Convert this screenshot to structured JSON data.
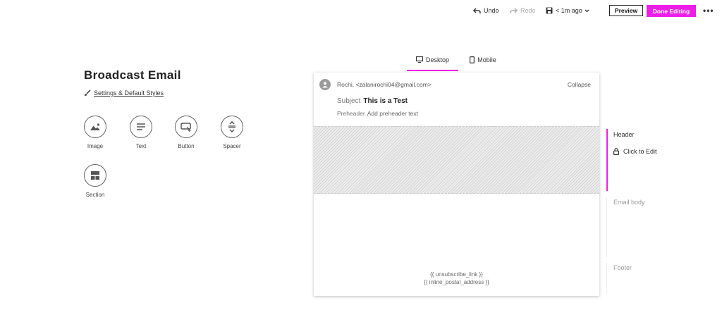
{
  "toolbar": {
    "undo_label": "Undo",
    "redo_label": "Redo",
    "save_status": "< 1m ago",
    "preview_label": "Preview",
    "done_label": "Done Editing",
    "more_label": "•••"
  },
  "left_panel": {
    "title": "Broadcast Email",
    "settings_link": "Settings & Default Styles",
    "blocks": [
      {
        "label": "Image",
        "icon": "image-icon"
      },
      {
        "label": "Text",
        "icon": "text-icon"
      },
      {
        "label": "Button",
        "icon": "button-icon"
      },
      {
        "label": "Spacer",
        "icon": "spacer-icon"
      },
      {
        "label": "Section",
        "icon": "section-icon"
      }
    ]
  },
  "view_tabs": [
    {
      "label": "Desktop",
      "icon": "desktop-icon",
      "active": true
    },
    {
      "label": "Mobile",
      "icon": "mobile-icon",
      "active": false
    }
  ],
  "envelope": {
    "from": "Rochi, <zalanirochi04@gmail.com>",
    "collapse_label": "Collapse",
    "subject_key": "Subject",
    "subject_value": "This is a Test",
    "preheader_key": "Preheader",
    "preheader_placeholder": "Add preheader text"
  },
  "footer_tokens": {
    "unsubscribe": "{{ unsubscribe_link }}",
    "postal": "{{ inline_postal_address }}"
  },
  "sections_rail": {
    "header_label": "Header",
    "click_to_edit": "Click to Edit",
    "body_label": "Email body",
    "footer_label": "Footer"
  },
  "colors": {
    "accent": "#ee1ee9",
    "text": "#333333",
    "muted": "#999999"
  }
}
